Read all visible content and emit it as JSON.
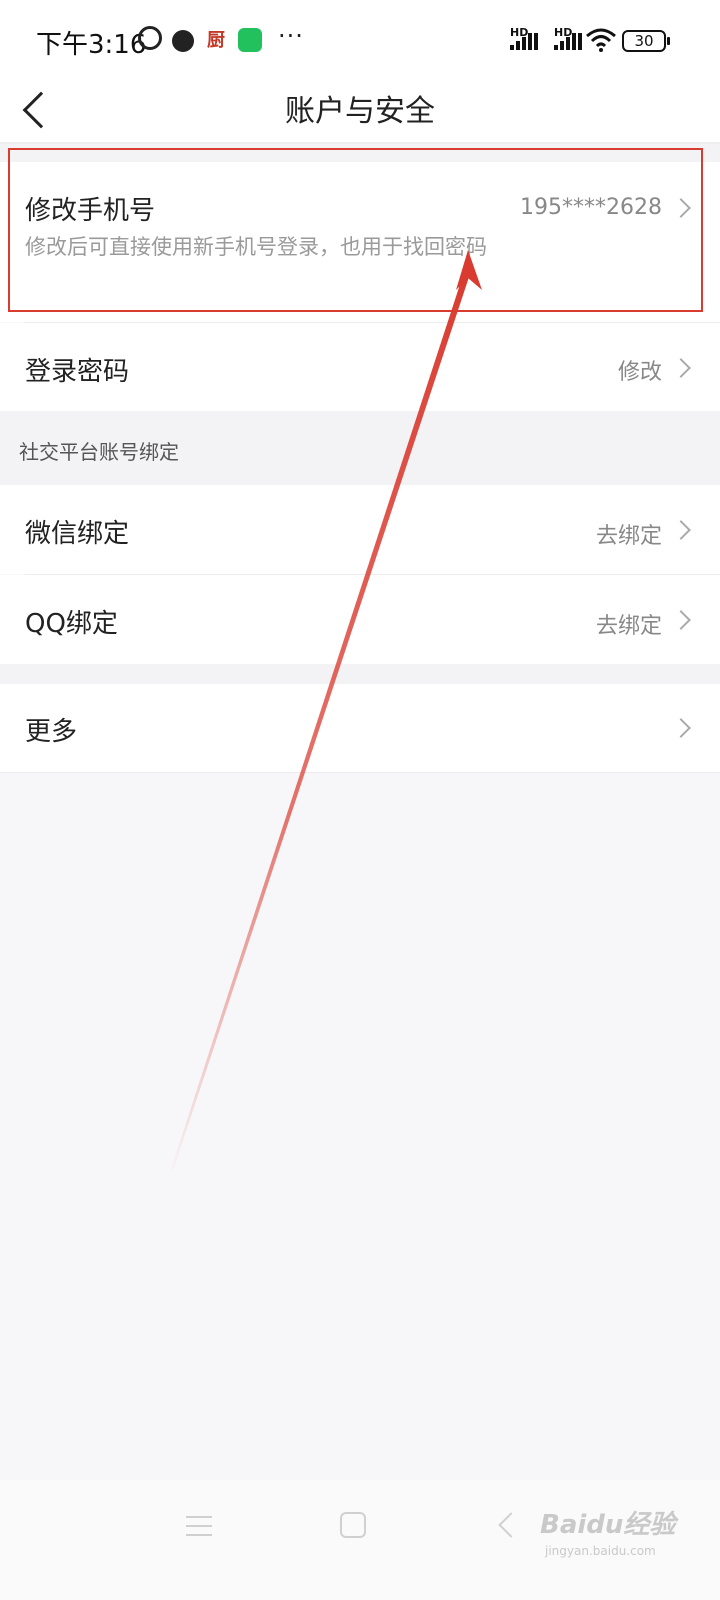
{
  "status_bar": {
    "time": "下午3:16",
    "app_icon_chu": "厨",
    "more": "···",
    "hd_1": "HD",
    "hd_2": "HD",
    "battery": "30"
  },
  "header": {
    "title": "账户与安全"
  },
  "phone": {
    "label": "修改手机号",
    "value": "195****2628",
    "description": "修改后可直接使用新手机号登录，也用于找回密码"
  },
  "password": {
    "label": "登录密码",
    "value": "修改"
  },
  "social": {
    "group_label": "社交平台账号绑定",
    "wechat": {
      "label": "微信绑定",
      "value": "去绑定"
    },
    "qq": {
      "label": "QQ绑定",
      "value": "去绑定"
    }
  },
  "more": {
    "label": "更多"
  },
  "watermark": {
    "brand": "Baidu经验",
    "url": "jingyan.baidu.com"
  },
  "colors": {
    "annotation": "#d93b30",
    "wechat": "#22c15e"
  }
}
